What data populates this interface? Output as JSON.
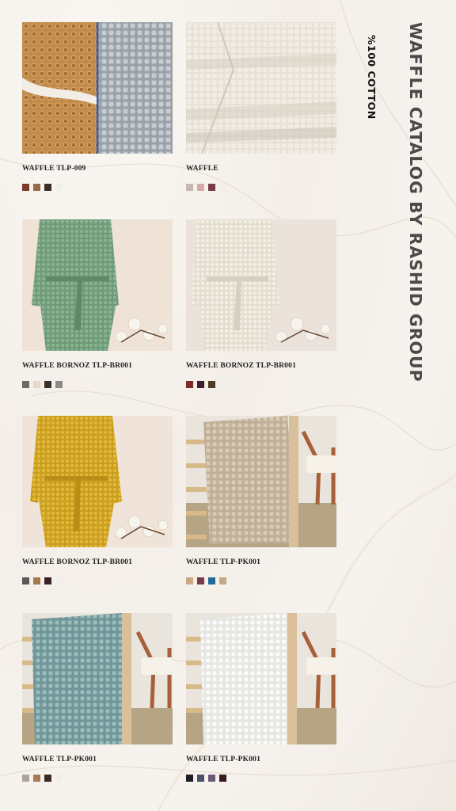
{
  "header": {
    "title": "WAFFLE CATALOG BY RASHID GROUP",
    "subtitle": "%100 COTTON"
  },
  "products": [
    {
      "name": "WAFFLE TLP-009",
      "photo": "orange-gray-waffle-swatch",
      "swatches": [
        "#7a3a2c",
        "#9a6a45",
        "#3a3028",
        "#f2eeea"
      ]
    },
    {
      "name": "WAFFLE",
      "photo": "folded-cream-waffle",
      "swatches": [
        "#c9b6b2",
        "#d9a8a8",
        "#7a3a4a",
        "#f2eeea"
      ]
    },
    {
      "name": "WAFFLE BORNOZ TLP-BR001",
      "photo": "green-robe",
      "swatches": [
        "#6a6a6a",
        "#e8d8c8",
        "#3a3028",
        "#8a8a8a"
      ]
    },
    {
      "name": "WAFFLE BORNOZ TLP-BR001",
      "photo": "cream-robe",
      "swatches": [
        "#7a2a28",
        "#3a2030",
        "#4a3a28",
        "#f2eeea"
      ]
    },
    {
      "name": "WAFFLE BORNOZ TLP-BR001",
      "photo": "yellow-robe",
      "swatches": [
        "#5a5a5a",
        "#a07a50",
        "#3a2028",
        "#f2eeea"
      ]
    },
    {
      "name": "WAFFLE TLP-PK001",
      "photo": "beige-blanket",
      "swatches": [
        "#c9a882",
        "#7a3a4a",
        "#1f6a9a",
        "#c8a888"
      ]
    },
    {
      "name": "WAFFLE TLP-PK001",
      "photo": "blue-blanket",
      "swatches": [
        "#b0a498",
        "#a87a58",
        "#3a2a22",
        "#f2eeea"
      ]
    },
    {
      "name": "WAFFLE TLP-PK001",
      "photo": "white-blanket",
      "swatches": [
        "#1e1e24",
        "#4a4e6a",
        "#6a5a7a",
        "#3a1a22"
      ]
    }
  ]
}
